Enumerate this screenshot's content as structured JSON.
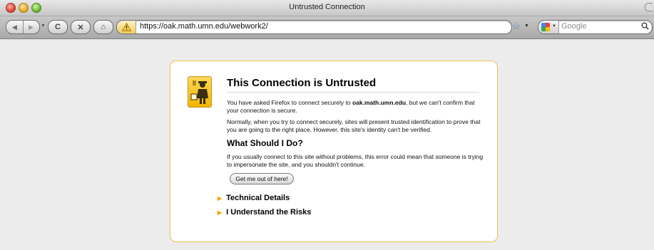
{
  "window": {
    "title": "Untrusted Connection"
  },
  "toolbar": {
    "url": "https://oak.math.umn.edu/webwork2/",
    "search_placeholder": "Google",
    "icons": {
      "back": "back-arrow-icon",
      "forward": "forward-arrow-icon",
      "reload": "reload-icon",
      "stop": "stop-icon",
      "home": "home-icon",
      "identity": "warning-icon",
      "bookmark": "star-icon",
      "search_engine": "google-icon",
      "search": "magnifier-icon"
    },
    "glyphs": {
      "back": "◀",
      "forward": "▶",
      "reload": "C",
      "stop": "✕",
      "home": "⌂",
      "star": "☆",
      "drop": "▼",
      "search": "🔍"
    }
  },
  "error": {
    "title": "This Connection is Untrusted",
    "p1_prefix": "You have asked Firefox to connect securely to ",
    "host": "oak.math.umn.edu",
    "p1_suffix": ", but we can't confirm that your connection is secure.",
    "p2": "Normally, when you try to connect securely, sites will present trusted identification to prove that you are going to the right place. However, this site's identity can't be verified.",
    "subheading": "What Should I Do?",
    "p3": "If you usually connect to this site without problems, this error could mean that someone is trying to impersonate the site, and you shouldn't continue.",
    "escape_button": "Get me out of here!",
    "technical_details": "Technical Details",
    "understand_risks": "I Understand the Risks"
  },
  "colors": {
    "box_border": "#f0c14d",
    "expander_arrow": "#f0a800",
    "icon_yellow": "#ffd95a"
  }
}
